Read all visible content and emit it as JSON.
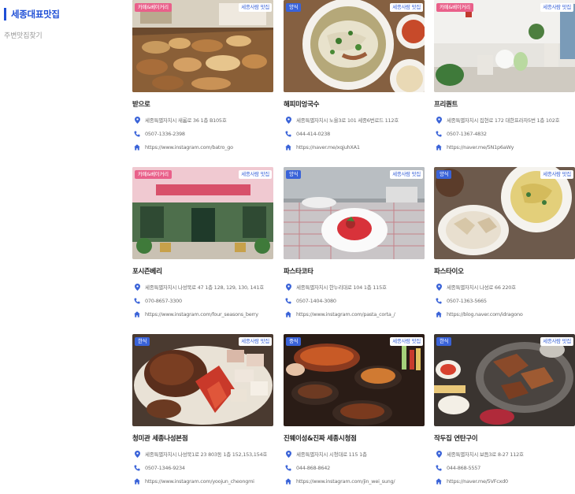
{
  "sidebar": {
    "active_label": "세종대표맛집",
    "item_label": "주변맛집찾기"
  },
  "colors": {
    "accent": "#1f4fd6",
    "badge_blue": "#3a63d8",
    "badge_pink": "#e9608a"
  },
  "icons": {
    "address": "location-pin-icon",
    "phone": "phone-icon",
    "link": "home-icon"
  },
  "restaurants": [
    {
      "category": "카페&베이커리",
      "category_style": "pink",
      "tag": "세종사람 맛집",
      "name": "받으로",
      "address": "세종특별자치시 새롬로 36 1층 B105호",
      "phone": "0507-1336-2398",
      "url": "https://www.instagram.com/batro_go"
    },
    {
      "category": "양식",
      "category_style": "blue",
      "tag": "세종사람 맛집",
      "name": "해피미엉국수",
      "address": "세종특별자치시 노을3로 101 세종6번로드 112호",
      "phone": "044-414-0238",
      "url": "https://naver.me/xqjuhXA1"
    },
    {
      "category": "카페&베이커리",
      "category_style": "pink",
      "tag": "세종사람 맛집",
      "name": "프리퀀트",
      "address": "세종특별자치시 집현로 172 대한프라자5번 1층 102호",
      "phone": "0507-1367-4832",
      "url": "https://naver.me/5N1p6aWy"
    },
    {
      "category": "카페&베이커리",
      "category_style": "pink",
      "tag": "세종사람 맛집",
      "name": "포시즌베리",
      "address": "세종특별자치시 나성북로 47 1층 128, 129, 130, 141호",
      "phone": "070-8657-3300",
      "url": "https://www.instagram.com/four_seasons_berry"
    },
    {
      "category": "양식",
      "category_style": "blue",
      "tag": "세종사람 맛집",
      "name": "파스타코타",
      "address": "세종특별자치시 한누리대로 104 1층 115호",
      "phone": "0507-1404-3080",
      "url": "https://www.instagram.com/pasta_corta_/"
    },
    {
      "category": "양식",
      "category_style": "blue",
      "tag": "세종사람 맛집",
      "name": "파스타이오",
      "address": "세종특별자치시 나성로 66 220호",
      "phone": "0507-1363-5665",
      "url": "https://blog.naver.com/idragono"
    },
    {
      "category": "한식",
      "category_style": "blue",
      "tag": "세종사람 맛집",
      "name": "청미관 세종나성본점",
      "address": "세종특별자치시 나성북1로 23 803동 1층 152,153,154호",
      "phone": "0507-1346-9234",
      "url": "https://www.instagram.com/yoojun_cheongmi"
    },
    {
      "category": "중식",
      "category_style": "blue",
      "tag": "세종사람 맛집",
      "name": "진웨이성&진짜 세종시청점",
      "address": "세종특별자치시 시청대로 115 1층",
      "phone": "044-868-8642",
      "url": "https://www.instagram.com/jin_wei_sung/"
    },
    {
      "category": "한식",
      "category_style": "blue",
      "tag": "세종사람 맛집",
      "name": "작두집 연탄구이",
      "address": "세종특별자치시 보듬3로 8-27 112호",
      "phone": "044-868-5557",
      "url": "https://naver.me/5VFcxd0"
    }
  ]
}
